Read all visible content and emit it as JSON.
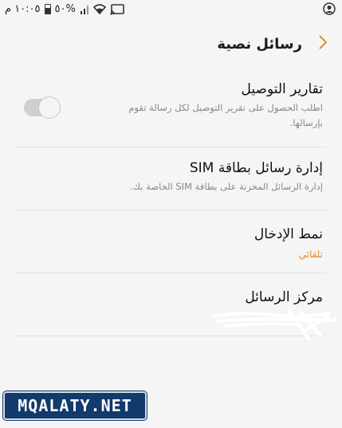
{
  "status_bar": {
    "time": "١٠:٠٥ م",
    "battery": "٥٠%"
  },
  "header": {
    "title": "رسائل نصية",
    "back_icon": "chevron-right-icon"
  },
  "settings": [
    {
      "title": "تقارير التوصيل",
      "subtitle_line1": "اطلب الحصول على تقرير التوصيل لكل رسالة تقوم",
      "subtitle_line2": "بإرسالها.",
      "toggle_on": false
    },
    {
      "title": "إدارة رسائل بطاقة SIM",
      "subtitle": "إدارة الرسائل المخزنة على بطاقة SIM الخاصة بك."
    },
    {
      "title": "نمط الإدخال",
      "value": "تلقائي"
    },
    {
      "title": "مركز الرسائل"
    }
  ],
  "watermark": {
    "text": "MQALATY.NET"
  },
  "colors": {
    "accent": "#e08a2a",
    "background": "#f5f5f5",
    "logo_bg": "#123a6c"
  }
}
